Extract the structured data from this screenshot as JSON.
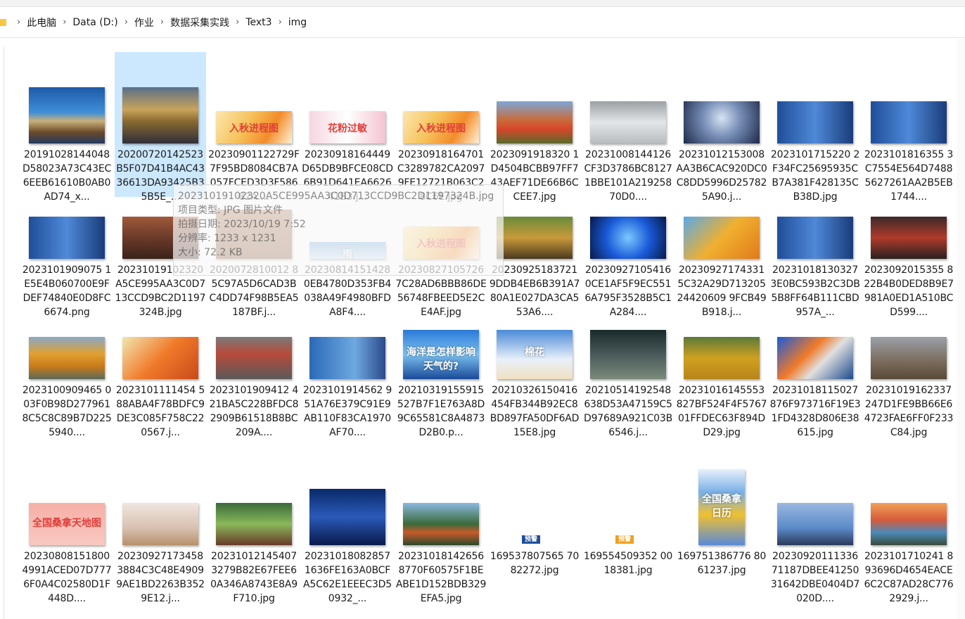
{
  "breadcrumb": [
    "此电脑",
    "Data (D:)",
    "作业",
    "数据采集实践",
    "Text3",
    "img"
  ],
  "breadcrumb_separator": "›",
  "tooltip": {
    "filename": "20231019102320A5CE995AA3C0D713CCD9BC2D1197324B.jpg",
    "type": "项目类型: JPG 图片文件",
    "date_taken": "拍摄日期: 2023/10/19 7:52",
    "resolution": "分辨率: 1233 x 1231",
    "size": "大小: 72.2 KB"
  },
  "files": [
    {
      "name": "20191028144048D58023A73C43EC6EEB61610B0AB0AD74_x...",
      "icon": "photo-castle-icon"
    },
    {
      "name": "20200720142523B5F07D41B4AC4336613DA93425B35B5E_...",
      "icon": "photo-golden-temple-icon"
    },
    {
      "name": "20230901122729F7F95BD8084CB7A057FCED3D3F58682A....",
      "icon": "poster-autumn-map-icon"
    },
    {
      "name": "20230918164449D65DB9BFCE08CD6B91D641EA662641B3.j...",
      "icon": "poster-pollen-allergy-icon"
    },
    {
      "name": "20230918164701C3289782CA20979FE12721B063C28C6E.jpg",
      "icon": "poster-autumn-map-icon"
    },
    {
      "name": "2023091918320 1D4504BCBB97FF743AEF71DE66B6CCEE7.jpg",
      "icon": "photo-autumn-hills-icon"
    },
    {
      "name": "20231008144126CF3D3786BC81271BBE101A21925870D0....",
      "icon": "photo-fog-icon"
    },
    {
      "name": "20231012153008AA3B6CAC920DC0C8DD5996D257825A90.j...",
      "icon": "photo-frost-icon"
    },
    {
      "name": "2023101715220 2F34FC25695935CB7A381F428135CB38D.jpg",
      "icon": "photo-weather-presenter-icon"
    },
    {
      "name": "2023101816355 3C7554E564D74885627261AA2B5EB1744....",
      "icon": "photo-weather-presenter-icon"
    },
    {
      "name": "2023101909075 1E5E4B060700E9FDEF74840E0D8FC6674.png",
      "icon": "photo-weather-presenter-icon"
    },
    {
      "name": "20231019102320A5CE995AA3C0D713CCD9BC2D1197324B.jpg",
      "icon": "photo-bench-icon"
    },
    {
      "name": "2020072810012 85C97A5D6CAD3BC4DD74F98B5EA5187BF.j...",
      "icon": "photo-brown-icon"
    },
    {
      "name": "20230814151428 0EB4780D353FB4038A49F4980BFDA8F4....",
      "icon": "poster-rain-icon"
    },
    {
      "name": "20230827105726 7C28AD6BBB86DE56748FBEED5E2CE4AF.jpg",
      "icon": "poster-autumn-map-icon"
    },
    {
      "name": "20230925183721 9DDB4EB6B391A780A1E027DA3CA553A6....",
      "icon": "photo-autumn-path-icon"
    },
    {
      "name": "20230927105416 0CE1AF5F9EC5516A795F3528B5C1A284....",
      "icon": "photo-blue-drops-icon"
    },
    {
      "name": "20230927174331 5C32A29D71320524420609 9FCB49B918.j...",
      "icon": "photo-yellow-leaves-icon"
    },
    {
      "name": "20231018130327 3E0BC593B2C3DB5B8FF64B111CBD957A_...",
      "icon": "photo-weather-presenter-icon"
    },
    {
      "name": "2023092015355 822B4B0DED8B9E7981A0ED1A510BCD599....",
      "icon": "photo-runner-icon"
    },
    {
      "name": "2023100909465 003F0B98D2779618C5C8C89B7D2255940....",
      "icon": "photo-autumn-forest-icon"
    },
    {
      "name": "2023101111454 588ABA4F78BDFC9DE3C085F758C220567.j...",
      "icon": "photo-orange-leaves-icon"
    },
    {
      "name": "2023101909412 421BA5C228BFDC82909B61518B8BC209A....",
      "icon": "photo-rain-street-icon"
    },
    {
      "name": "2023101914562 951A76E379C91E9AB110F83CA1970AF70....",
      "icon": "photo-weather-studio-icon"
    },
    {
      "name": "20210319155915527B7F1E763A8D9C65581C8A4873D2B0.p...",
      "icon": "poster-ocean-icon"
    },
    {
      "name": "20210326150416454FB344B92EC8BD897FA50DF6AD15E8.jpg",
      "icon": "poster-cotton-icon"
    },
    {
      "name": "20210514192548638D53A47159C5D97689A921C03B6546.j...",
      "icon": "photo-storm-icon"
    },
    {
      "name": "20231016145553827BF524F4F576701FFDEC63F894DD29.jpg",
      "icon": "photo-rice-field-icon"
    },
    {
      "name": "20231018115027876F973716F19E31FD4328D806E38615.jpg",
      "icon": "photo-satellite-icon"
    },
    {
      "name": "20231019162337247D1FE9BB66E64723FAE6FF0F233C84.jpg",
      "icon": "photo-flood-icon"
    },
    {
      "name": "20230808151800 4991ACED07D7776F0A4C02580D1F448D....",
      "icon": "poster-sauna-icon"
    },
    {
      "name": "20230927173458 3884C3C48E49099AE1BD2263B3529E12.j...",
      "icon": "photo-tea-cup-icon"
    },
    {
      "name": "20231012145407 3279B82E67FEE60A346A8743E8A9F710.jpg",
      "icon": "photo-vegetables-icon"
    },
    {
      "name": "20231018082857 1636FE163A0BCFA5C62E1EEEC3D50932_...",
      "icon": "photo-conference-icon"
    },
    {
      "name": "20231018142656 8770F60575F1BEABE1D152BDB329EFA5.jpg",
      "icon": "photo-mountains-icon"
    },
    {
      "name": "169537807565 7082272.jpg",
      "icon": "warning-badge-blue-icon",
      "badge": "预警",
      "badge_color": "#1d4f9a"
    },
    {
      "name": "169554509352 0018381.jpg",
      "icon": "warning-badge-orange-icon",
      "badge": "预警",
      "badge_color": "#f0a020"
    },
    {
      "name": "169751386776 8061237.jpg",
      "icon": "poster-calendar-icon"
    },
    {
      "name": "20230920111336 71187DBEE4125031642DBE0404D7020D....",
      "icon": "photo-street-lamp-icon"
    },
    {
      "name": "2023101710241 893696D4654EACE6C2C87AD28C7762929.j...",
      "icon": "photo-aerial-city-icon"
    }
  ],
  "thumb_captions": {
    "poster-autumn-map-icon": "入秋进程图",
    "poster-pollen-allergy-icon": "花粉过敏",
    "poster-ocean-icon": "海洋是怎样影响天气的?",
    "poster-cotton-icon": "棉花",
    "poster-sauna-icon": "全国桑拿天地图",
    "poster-rain-icon": "雨",
    "poster-calendar-icon": "全国桑拿日历"
  },
  "selected_index": 1
}
